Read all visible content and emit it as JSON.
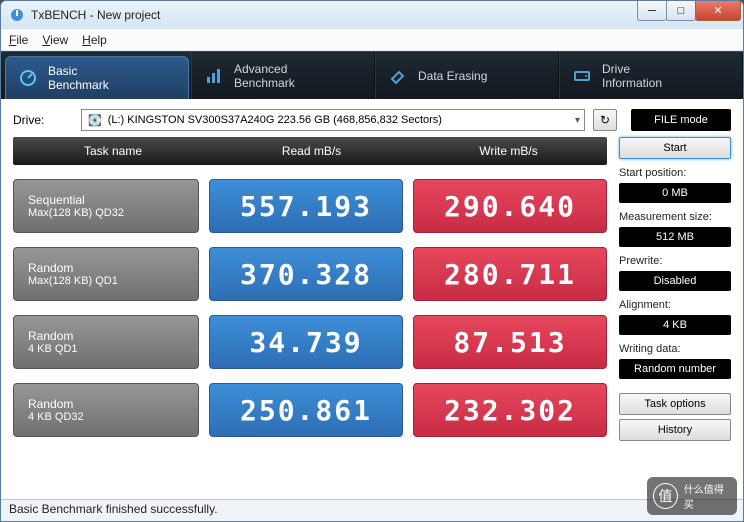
{
  "window": {
    "title": "TxBENCH - New project"
  },
  "menu": {
    "file": "File",
    "view": "View",
    "help": "Help"
  },
  "tabs": {
    "basic": {
      "line1": "Basic",
      "line2": "Benchmark"
    },
    "advanced": {
      "line1": "Advanced",
      "line2": "Benchmark"
    },
    "erase": {
      "line1": "Data Erasing",
      "line2": ""
    },
    "drive": {
      "line1": "Drive",
      "line2": "Information"
    }
  },
  "drive": {
    "label": "Drive:",
    "selected": "(L:) KINGSTON SV300S37A240G  223.56 GB (468,856,832 Sectors)"
  },
  "filemode": "FILE mode",
  "columns": {
    "task": "Task name",
    "read": "Read mB/s",
    "write": "Write mB/s"
  },
  "rows": [
    {
      "name1": "Sequential",
      "name2": "Max(128 KB) QD32",
      "read": "557.193",
      "write": "290.640"
    },
    {
      "name1": "Random",
      "name2": "Max(128 KB) QD1",
      "read": "370.328",
      "write": "280.711"
    },
    {
      "name1": "Random",
      "name2": "4 KB QD1",
      "read": "34.739",
      "write": "87.513"
    },
    {
      "name1": "Random",
      "name2": "4 KB QD32",
      "read": "250.861",
      "write": "232.302"
    }
  ],
  "side": {
    "start": "Start",
    "startpos_label": "Start position:",
    "startpos_value": "0 MB",
    "meassize_label": "Measurement size:",
    "meassize_value": "512 MB",
    "prewrite_label": "Prewrite:",
    "prewrite_value": "Disabled",
    "align_label": "Alignment:",
    "align_value": "4 KB",
    "wdata_label": "Writing data:",
    "wdata_value": "Random number",
    "taskopt": "Task options",
    "history": "History"
  },
  "status": "Basic Benchmark finished successfully.",
  "watermark": {
    "face": "值",
    "text": "什么值得买"
  }
}
